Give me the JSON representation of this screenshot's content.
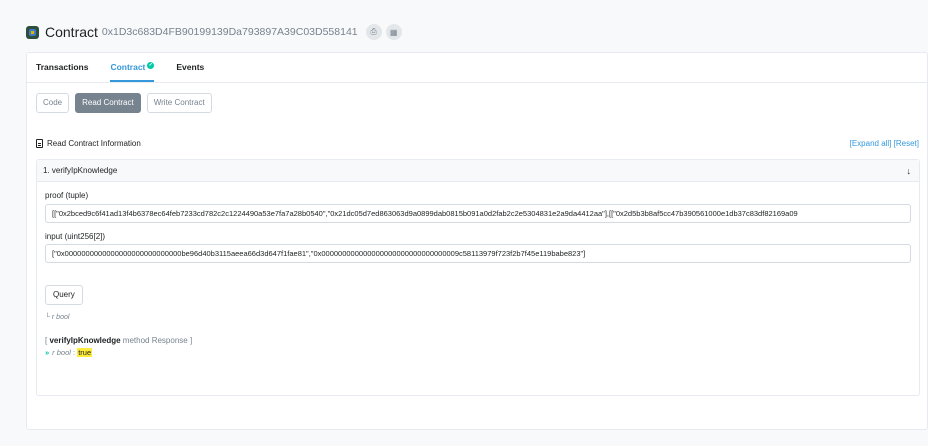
{
  "header": {
    "title": "Contract",
    "address": "0x1D3c683D4FB90199139Da793897A39C03D558141",
    "copy_icon": "copy-icon",
    "qr_icon": "qr-icon"
  },
  "tabs": [
    {
      "label": "Transactions"
    },
    {
      "label": "Contract"
    },
    {
      "label": "Events"
    }
  ],
  "subtabs": [
    {
      "label": "Code"
    },
    {
      "label": "Read Contract"
    },
    {
      "label": "Write Contract"
    }
  ],
  "info": {
    "title": "Read Contract Information",
    "expand_all": "[Expand all]",
    "reset": "[Reset]"
  },
  "method": {
    "header": "1. verifyIpKnowledge",
    "proof_label": "proof (tuple)",
    "proof_value": "[[\"0x2bced9c6f41ad13f4b6378ec64feb7233cd782c2c1224490a53e7fa7a28b0540\",\"0x21dc05d7ed863063d9a0899dab0815b091a0d2fab2c2e5304831e2a9da4412aa\"],[[\"0x2d5b3b8af5cc47b390561000e1db37c83df82169a09",
    "input_label": "input (uint256[2])",
    "input_value": "[\"0x0000000000000000000000000000be96d40b3115aeea66d3d647f1fae81\",\"0x000000000000000000000000000000009c58113979f723f2b7f45e119babe823\"]",
    "query_label": "Query",
    "return_prefix": "└ ",
    "return_type": "r bool",
    "response_open": "[ ",
    "response_method": "verifyIpKnowledge",
    "response_close": " method Response ]",
    "response_chevron": "»",
    "response_name": "r",
    "response_type": "bool",
    "response_sep": " : ",
    "response_value": "true"
  },
  "colors": {
    "accent": "#3498db",
    "success": "#00c9a7",
    "highlight": "#ffeb3b",
    "muted": "#77838f"
  }
}
